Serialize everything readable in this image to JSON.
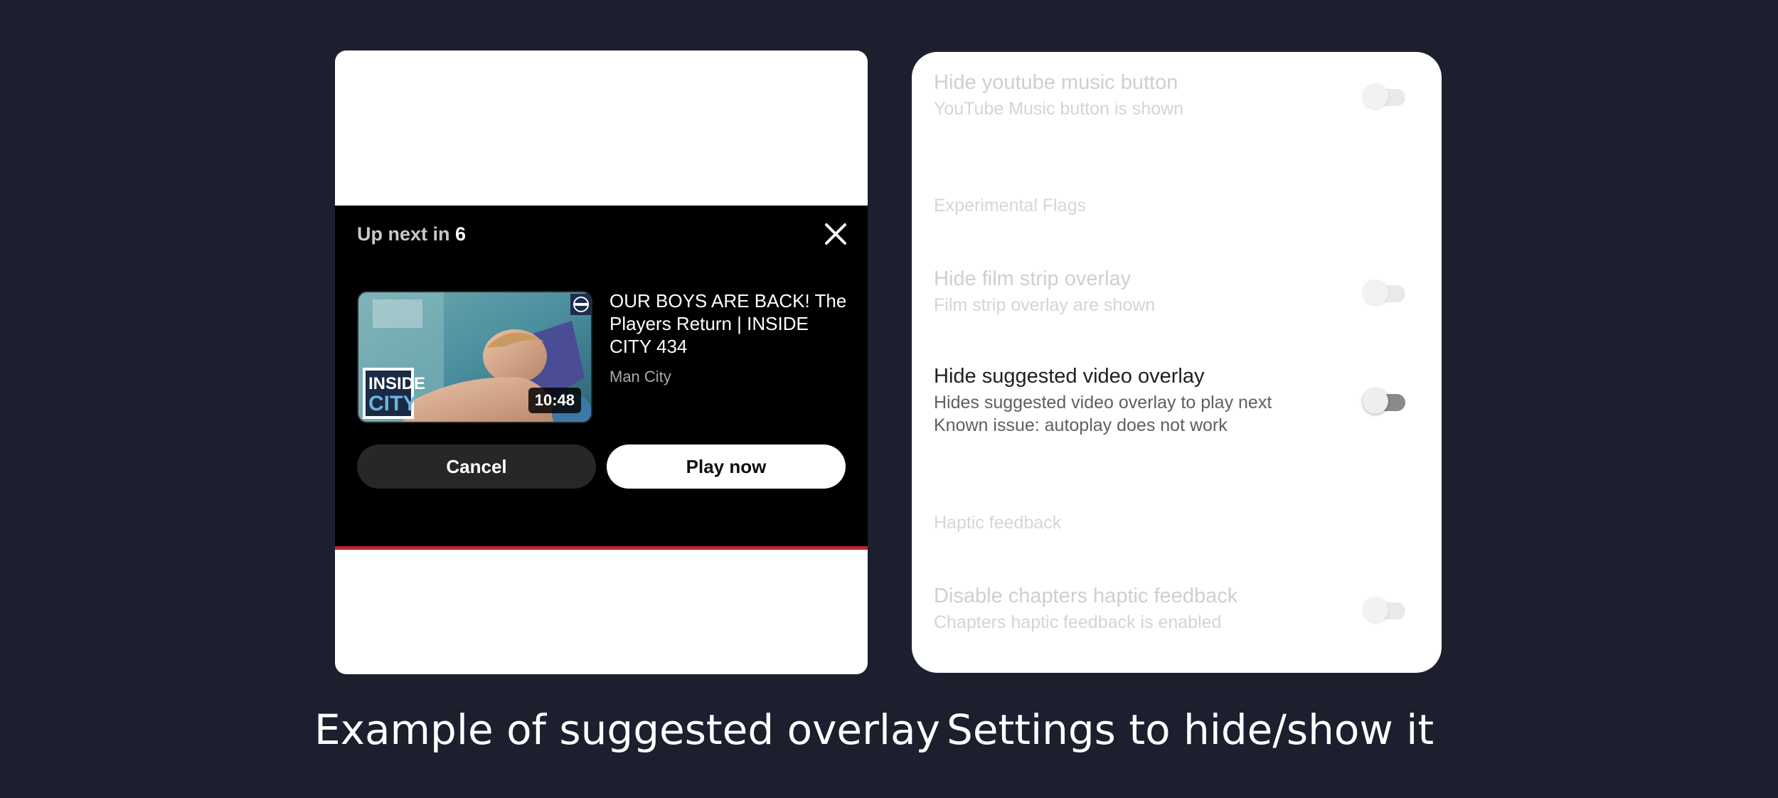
{
  "overlay_example": {
    "up_next_prefix": "Up next in",
    "countdown": "6",
    "video": {
      "title": "OUR BOYS ARE BACK! The Players Return | INSIDE CITY 434",
      "channel": "Man City",
      "duration": "10:48",
      "thumbnail_logo_text_1": "INSIDE",
      "thumbnail_logo_text_2": "CITY"
    },
    "cancel_label": "Cancel",
    "play_label": "Play now",
    "progress_color": "#c4232b"
  },
  "settings": {
    "items": [
      {
        "title": "Hide youtube music button",
        "subtitle": "YouTube Music button is shown",
        "enabled": false
      },
      {
        "section": "Experimental Flags"
      },
      {
        "title": "Hide film strip overlay",
        "subtitle": "Film strip overlay are shown",
        "enabled": false
      },
      {
        "title": "Hide suggested video overlay",
        "subtitle_line1": "Hides suggested video overlay to play next",
        "subtitle_line2": "Known issue: autoplay does not work",
        "enabled": false
      },
      {
        "section": "Haptic feedback"
      },
      {
        "title": "Disable chapters haptic feedback",
        "subtitle": "Chapters haptic feedback is enabled",
        "enabled": false
      }
    ]
  },
  "captions": {
    "left": "Example of suggested overlay",
    "right": "Settings to hide/show it"
  }
}
